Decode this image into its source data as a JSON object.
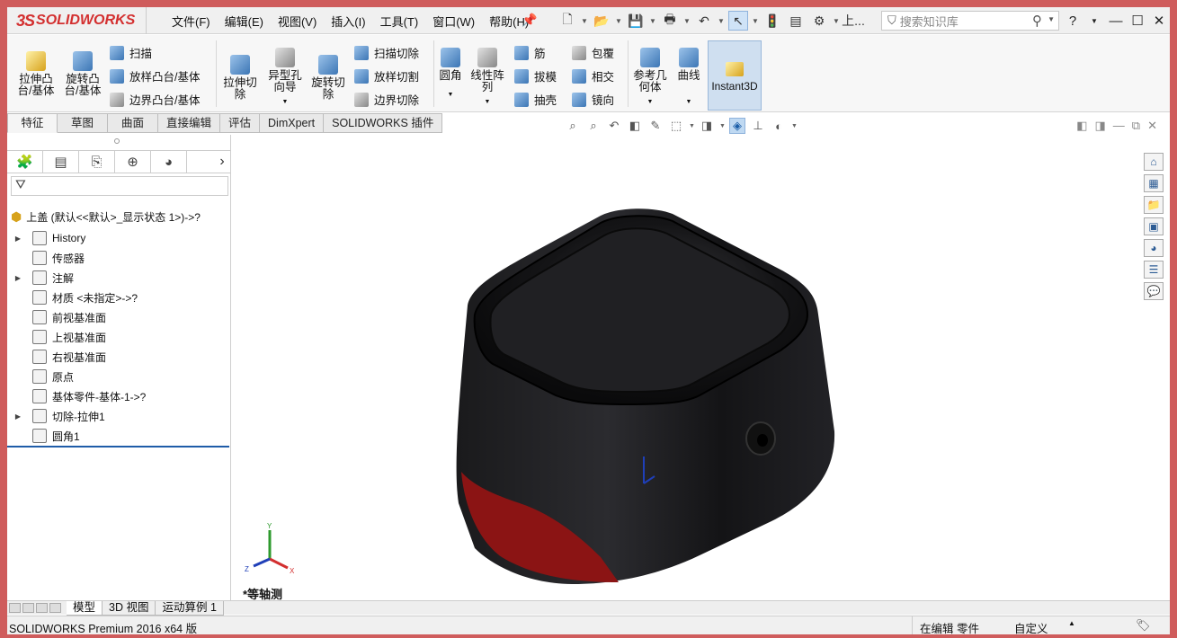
{
  "app": {
    "logo": "SOLIDWORKS",
    "logo_mark": "3S"
  },
  "menu": [
    "文件(F)",
    "编辑(E)",
    "视图(V)",
    "插入(I)",
    "工具(T)",
    "窗口(W)",
    "帮助(H)"
  ],
  "quick_access": {
    "overflow": "上..."
  },
  "search": {
    "placeholder": "搜索知识库"
  },
  "window_controls": {
    "help": "?",
    "minimize": "—",
    "maximize": "☐",
    "close": "✕"
  },
  "ribbon": {
    "extrude_boss": "拉伸凸台/基体",
    "revolve_boss": "旋转凸台/基体",
    "sweep": "扫描",
    "loft": "放样凸台/基体",
    "boundary": "边界凸台/基体",
    "extrude_cut": "拉伸切除",
    "hole_wizard": "异型孔向导",
    "revolve_cut": "旋转切除",
    "swept_cut": "扫描切除",
    "lofted_cut": "放样切割",
    "boundary_cut": "边界切除",
    "fillet": "圆角",
    "linear_pattern": "线性阵列",
    "rib": "筋",
    "draft": "拔模",
    "shell": "抽壳",
    "wrap": "包覆",
    "intersect": "相交",
    "mirror": "镜向",
    "ref_geometry": "参考几何体",
    "curves": "曲线",
    "instant3d": "Instant3D"
  },
  "cm_tabs": [
    "特征",
    "草图",
    "曲面",
    "直接编辑",
    "评估",
    "DimXpert",
    "SOLIDWORKS 插件"
  ],
  "feature_tree": {
    "root": "上盖  (默认<<默认>_显示状态 1>)->?",
    "nodes": [
      {
        "label": "History",
        "expand": "▶"
      },
      {
        "label": "传感器",
        "expand": ""
      },
      {
        "label": "注解",
        "expand": "▶"
      },
      {
        "label": "材质 <未指定>->?",
        "expand": ""
      },
      {
        "label": "前视基准面",
        "expand": ""
      },
      {
        "label": "上视基准面",
        "expand": ""
      },
      {
        "label": "右视基准面",
        "expand": ""
      },
      {
        "label": "原点",
        "expand": ""
      },
      {
        "label": "基体零件-基体-1->?",
        "expand": ""
      },
      {
        "label": "切除-拉伸1",
        "expand": "▶"
      },
      {
        "label": "圆角1",
        "expand": ""
      }
    ]
  },
  "viewport": {
    "view_name": "*等轴测",
    "triad_x": "X",
    "triad_y": "Y",
    "triad_z": "Z"
  },
  "bottom_tabs": [
    "模型",
    "3D 视图",
    "运动算例 1"
  ],
  "status": {
    "product": "SOLIDWORKS Premium 2016 x64 版",
    "mode": "在编辑 零件",
    "units": "自定义",
    "units_arrow": "▲"
  },
  "colors": {
    "accent": "#1f5ca8",
    "frame": "#cf5c5c",
    "model_body": "#1a1a1c",
    "model_accent": "#8b1414"
  }
}
